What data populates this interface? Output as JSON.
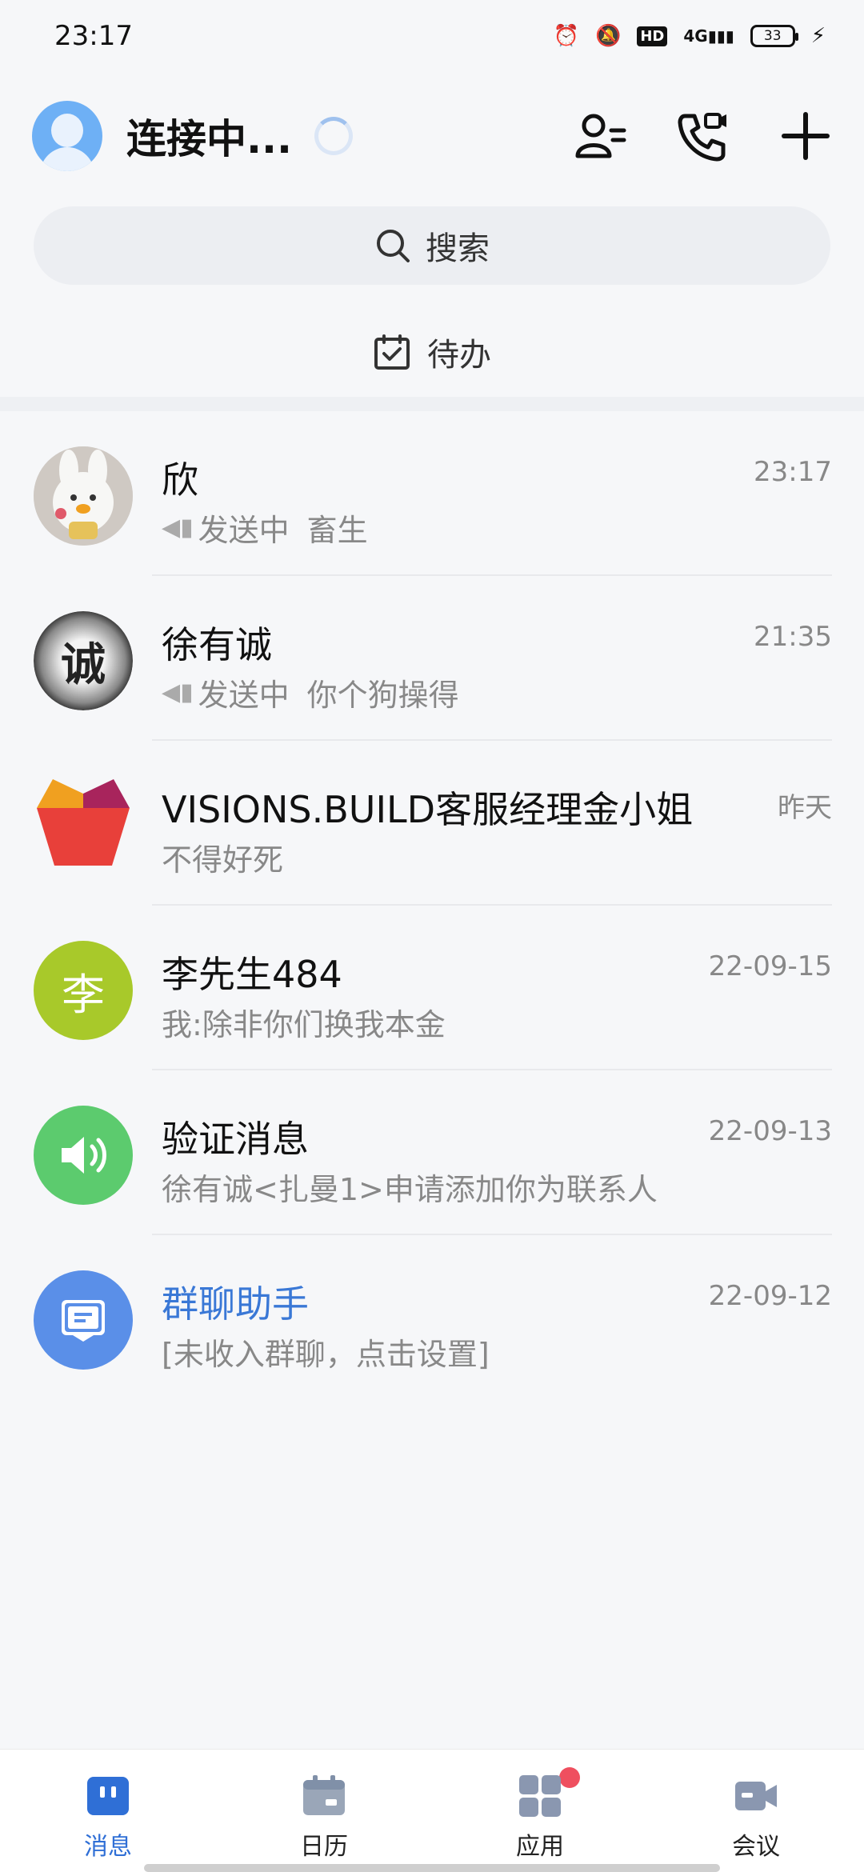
{
  "status_bar": {
    "time": "23:17",
    "hd": "HD",
    "network": "4G",
    "battery": "33"
  },
  "header": {
    "title": "连接中...",
    "accent": "#2f6fd6"
  },
  "search": {
    "label": "搜索"
  },
  "todo": {
    "label": "待办"
  },
  "conversations": [
    {
      "name": "欣",
      "time": "23:17",
      "status": "发送中",
      "preview": "畜生"
    },
    {
      "name": "徐有诚",
      "time": "21:35",
      "status": "发送中",
      "preview": "你个狗操得",
      "avatar_text": "诚"
    },
    {
      "name": "VISIONS.BUILD客服经理金小姐",
      "time": "昨天",
      "preview": "不得好死"
    },
    {
      "name": "李先生484",
      "time": "22-09-15",
      "preview": "我:除非你们换我本金",
      "avatar_text": "李",
      "avatar_color": "#a8c92a"
    },
    {
      "name": "验证消息",
      "time": "22-09-13",
      "preview": "徐有诚<扎曼1>申请添加你为联系人",
      "avatar_color": "#5ccb6e"
    },
    {
      "name": "群聊助手",
      "time": "22-09-12",
      "preview": "[未收入群聊，点击设置]",
      "avatar_color": "#5a8fe8"
    }
  ],
  "tabs": [
    {
      "label": "消息",
      "active": true
    },
    {
      "label": "日历"
    },
    {
      "label": "应用",
      "badge": true
    },
    {
      "label": "会议"
    }
  ]
}
